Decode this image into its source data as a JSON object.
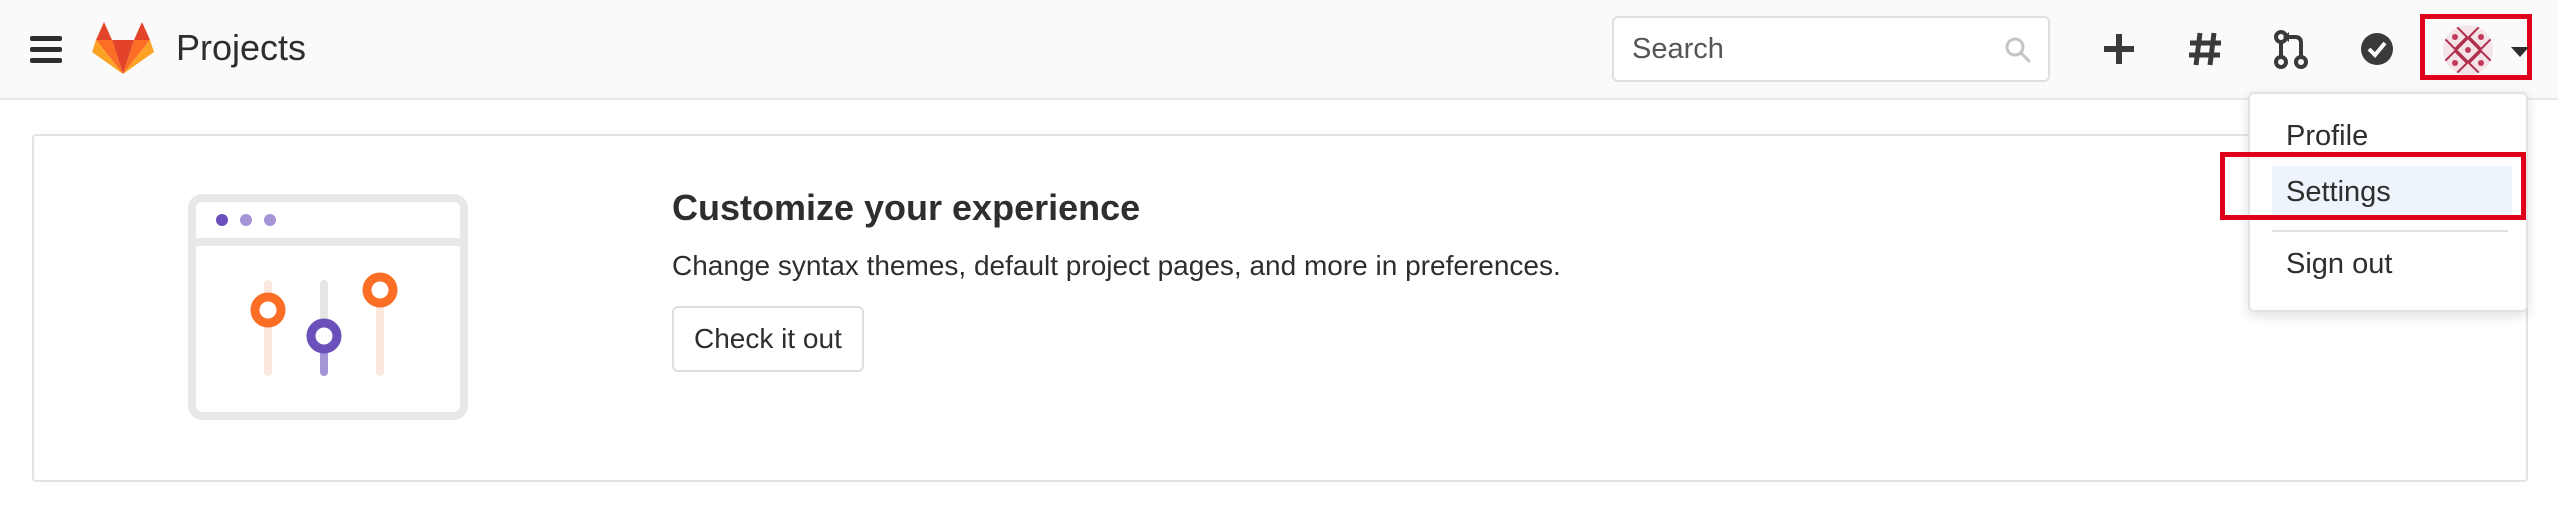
{
  "header": {
    "title": "Projects",
    "search_placeholder": "Search",
    "icons": [
      "hamburger-menu-icon",
      "gitlab-logo",
      "search-icon",
      "plus-icon",
      "hash-icon",
      "merge-request-icon",
      "check-circle-icon",
      "avatar",
      "caret-down-icon"
    ]
  },
  "user_menu": {
    "items": [
      {
        "label": "Profile"
      },
      {
        "label": "Settings"
      },
      {
        "label": "Sign out"
      }
    ]
  },
  "promo_card": {
    "heading": "Customize your experience",
    "text": "Change syntax themes, default project pages, and more in preferences.",
    "button_label": "Check it out"
  },
  "colors": {
    "accent_orange": "#fc6d26",
    "purple": "#6b4fbb",
    "highlight_red": "#e0001b"
  }
}
